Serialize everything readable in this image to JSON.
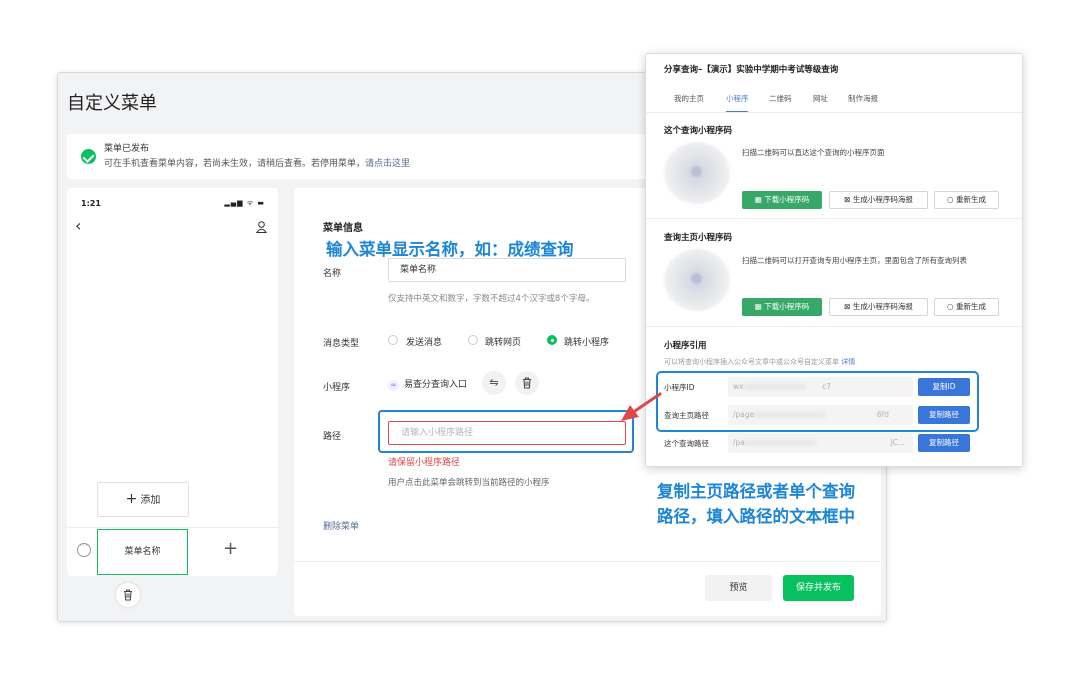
{
  "page": {
    "title": "自定义菜单",
    "banner": {
      "status": "菜单已发布",
      "message": "可在手机查看菜单内容，若尚未生效，请稍后查看。若停用菜单，",
      "link": "请点击这里"
    }
  },
  "phone": {
    "time": "1:21",
    "status_icons": "▂▄▆ ᯤ ▬",
    "back_icon": "‹",
    "add_label": "添加",
    "add_plus": "+",
    "menu_item": "菜单名称",
    "menu_add": "+"
  },
  "editor": {
    "section_title": "菜单信息",
    "name_label": "名称",
    "name_value": "菜单名称",
    "name_hint": "仅支持中英文和数字，字数不超过4个汉字或8个字母。",
    "msg_type_label": "消息类型",
    "msg_types": [
      "发送消息",
      "跳转网页",
      "跳转小程序"
    ],
    "msg_type_selected": "跳转小程序",
    "miniprogram_label": "小程序",
    "miniprogram_name": "易查分查询入口",
    "path_label": "路径",
    "path_placeholder": "请输入小程序路径",
    "path_error": "请保留小程序路径",
    "path_hint": "用户点击此菜单会跳转到当前路径的小程序",
    "delete_label": "删除菜单",
    "preview_label": "预览",
    "publish_label": "保存并发布"
  },
  "annotations": {
    "name_tip": "输入菜单显示名称，如：成绩查询",
    "path_tip_line1": "复制主页路径或者单个查询",
    "path_tip_line2": "路径，填入路径的文本框中"
  },
  "share": {
    "title": "分享查询–【演示】实验中学期中考试等级查询",
    "tabs": [
      "我的主页",
      "小程序",
      "二维码",
      "网址",
      "制作海报"
    ],
    "active_tab": "小程序",
    "query_code": {
      "title": "这个查询小程序码",
      "desc": "扫描二维码可以直达这个查询的小程序页面",
      "download": "下载小程序码",
      "poster": "生成小程序码海报",
      "regen": "重新生成"
    },
    "home_code": {
      "title": "查询主页小程序码",
      "desc": "扫描二维码可以打开查询专用小程序主页，里面包含了所有查询列表",
      "download": "下载小程序码",
      "poster": "生成小程序码海报",
      "regen": "重新生成"
    },
    "reference": {
      "title": "小程序引用",
      "hint": "可以将查询小程序插入公众号文章中或公众号自定义菜单",
      "hint_link": "详情",
      "rows": [
        {
          "label": "小程序ID",
          "value_start": "wx",
          "value_end": "c7",
          "button": "复制ID"
        },
        {
          "label": "查询主页路径",
          "value_start": "/page",
          "value_end": "6fd",
          "button": "复制路径"
        },
        {
          "label": "这个查询路径",
          "value_start": "/pa",
          "value_end": "jC...",
          "button": "复制路径"
        }
      ]
    }
  }
}
